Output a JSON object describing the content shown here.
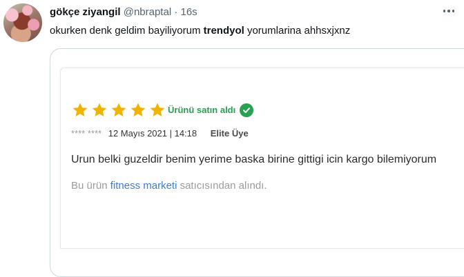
{
  "tweet": {
    "author_name": "gökçe ziyangil",
    "handle": "@nbraptal",
    "separator": "·",
    "time": "16s",
    "text_before": "okurken denk geldim bayiliyorum ",
    "text_bold": "trendyol",
    "text_after": " yorumlarina ahhsxjxnz"
  },
  "review": {
    "rating": 5,
    "rating_max": 5,
    "star_color": "#f2b200",
    "purchased_label": "Ürünü satın aldı",
    "purchased_color": "#27a050",
    "user_masked": "**** ****",
    "date": "12 Mayıs 2021 | 14:18",
    "separator": "•",
    "badge": "Elite Üye",
    "comment": "Urun belki guzeldir benim yerime baska birine gittigi icin kargo bilemiyorum",
    "seller_prefix": "Bu ürün ",
    "seller_name": "fitness marketi",
    "seller_suffix": " satıcısından alındı.",
    "link_color": "#3b7ecf"
  },
  "icons": {
    "more": "more-horizontal-icon",
    "verified": "checkmark-circle-icon",
    "star": "star-icon"
  }
}
